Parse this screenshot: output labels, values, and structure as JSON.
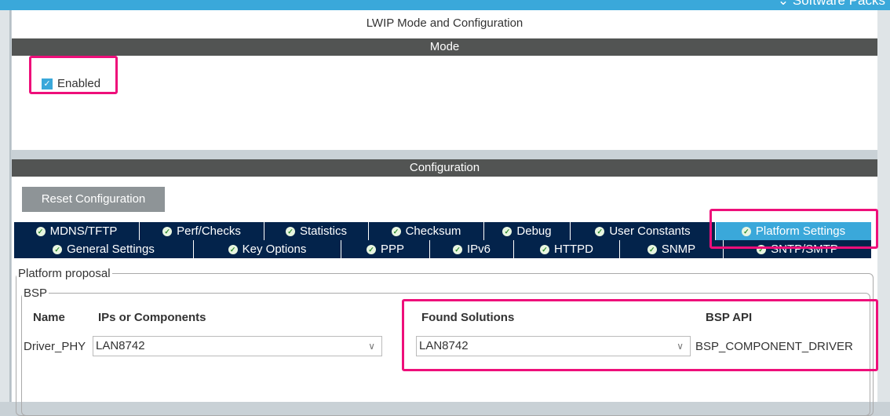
{
  "topbar": {
    "software_packs": "⌄ Software Packs"
  },
  "title": "LWIP Mode and Configuration",
  "mode": {
    "header": "Mode",
    "enabled_label": "Enabled",
    "enabled": true
  },
  "configuration": {
    "header": "Configuration",
    "reset_label": "Reset Configuration",
    "tabs_row1": [
      {
        "label": "MDNS/TFTP"
      },
      {
        "label": "Perf/Checks"
      },
      {
        "label": "Statistics"
      },
      {
        "label": "Checksum"
      },
      {
        "label": "Debug"
      },
      {
        "label": "User Constants"
      },
      {
        "label": "Platform Settings",
        "active": true
      }
    ],
    "tabs_row2": [
      {
        "label": "General Settings"
      },
      {
        "label": "Key Options"
      },
      {
        "label": "PPP"
      },
      {
        "label": "IPv6"
      },
      {
        "label": "HTTPD"
      },
      {
        "label": "SNMP"
      },
      {
        "label": "SNTP/SMTP"
      }
    ]
  },
  "platform": {
    "legend": "Platform proposal",
    "bsp_legend": "BSP",
    "headers": {
      "name": "Name",
      "ips": "IPs or Components",
      "found": "Found Solutions",
      "api": "BSP API"
    },
    "row": {
      "name": "Driver_PHY",
      "ip_value": "LAN8742",
      "found_value": "LAN8742",
      "api": "BSP_COMPONENT_DRIVER"
    }
  }
}
